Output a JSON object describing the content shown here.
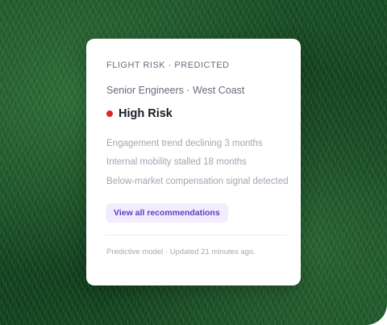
{
  "card": {
    "eyebrow": "FLIGHT RISK · PREDICTED",
    "segment": "Senior Engineers · West Coast",
    "risk": {
      "label": "High Risk",
      "color": "#dc2626"
    },
    "signals": [
      "Engagement trend declining 3 months",
      "Internal mobility stalled 18 months",
      "Below-market compensation signal detected"
    ],
    "action_label": "View all recommendations",
    "footnote": "Predictive model · Updated 21 minutes ago."
  },
  "colors": {
    "accent": "#5b3ec8",
    "accent_bg": "#f2ecff",
    "background": "#174a24"
  }
}
